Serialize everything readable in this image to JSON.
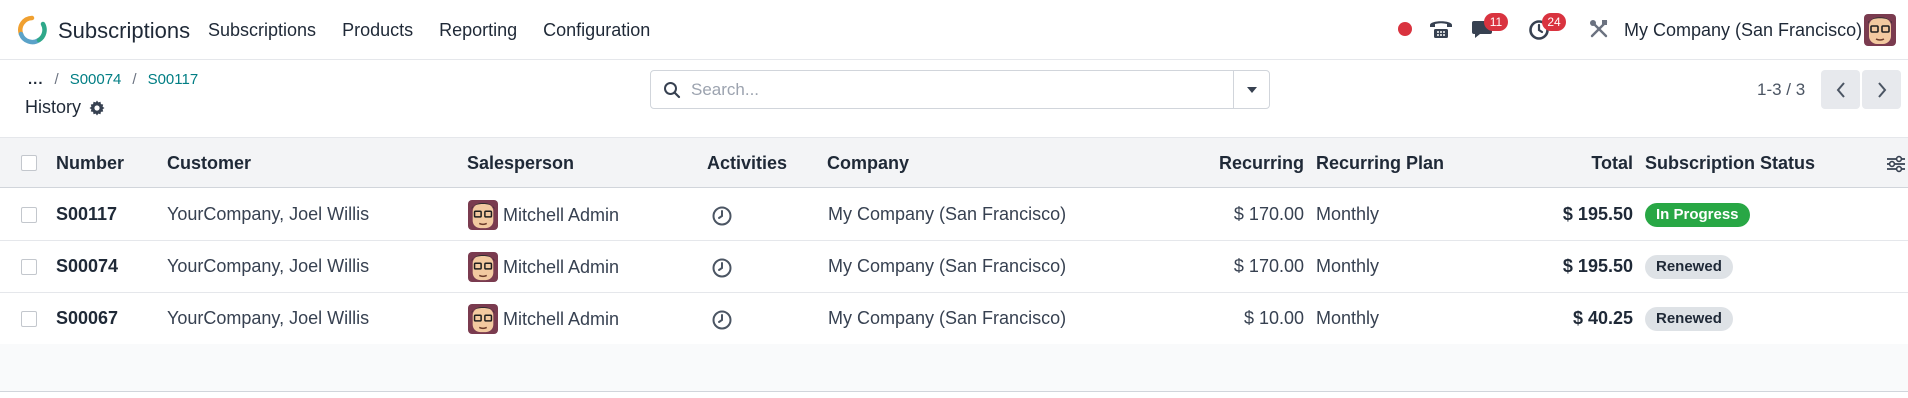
{
  "app": {
    "name": "Subscriptions"
  },
  "nav": {
    "menu": [
      "Subscriptions",
      "Products",
      "Reporting",
      "Configuration"
    ]
  },
  "systray": {
    "messages_count": "11",
    "activities_count": "24",
    "company": "My Company (San Francisco)"
  },
  "breadcrumb": {
    "dots": "...",
    "items": [
      "S00074",
      "S00117"
    ]
  },
  "view": {
    "title": "History"
  },
  "search": {
    "placeholder": "Search..."
  },
  "pager": {
    "text": "1-3 / 3"
  },
  "table": {
    "headers": {
      "number": "Number",
      "customer": "Customer",
      "salesperson": "Salesperson",
      "activities": "Activities",
      "company": "Company",
      "recurring": "Recurring",
      "plan": "Recurring Plan",
      "total": "Total",
      "status": "Subscription Status"
    },
    "rows": [
      {
        "number": "S00117",
        "customer": "YourCompany, Joel Willis",
        "salesperson": "Mitchell Admin",
        "company": "My Company (San Francisco)",
        "recurring": "$ 170.00",
        "plan": "Monthly",
        "total": "$ 195.50",
        "status": "In Progress"
      },
      {
        "number": "S00074",
        "customer": "YourCompany, Joel Willis",
        "salesperson": "Mitchell Admin",
        "company": "My Company (San Francisco)",
        "recurring": "$ 170.00",
        "plan": "Monthly",
        "total": "$ 195.50",
        "status": "Renewed"
      },
      {
        "number": "S00067",
        "customer": "YourCompany, Joel Willis",
        "salesperson": "Mitchell Admin",
        "company": "My Company (San Francisco)",
        "recurring": "$ 10.00",
        "plan": "Monthly",
        "total": "$ 40.25",
        "status": "Renewed"
      }
    ]
  },
  "colors": {
    "accent": "#017e84",
    "badge": "#d9333f",
    "in_progress": "#28a745",
    "renewed": "#dee2e6"
  },
  "icons": [
    "app-logo-icon",
    "record-dot-icon",
    "phone-icon",
    "chat-icon",
    "clock-icon",
    "tools-icon",
    "gear-icon",
    "search-icon",
    "caret-down-icon",
    "chevron-left-icon",
    "chevron-right-icon",
    "column-settings-icon"
  ]
}
